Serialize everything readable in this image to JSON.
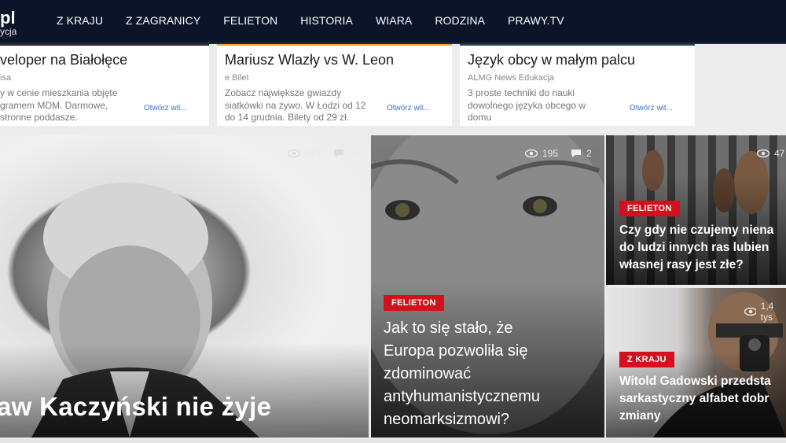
{
  "logo": {
    "line1": "pl",
    "line2": "ycja"
  },
  "nav": [
    "Z KRAJU",
    "Z ZAGRANICY",
    "FELIETON",
    "HISTORIA",
    "WIARA",
    "RODZINA",
    "PRAWY.TV"
  ],
  "ads": [
    {
      "title": "veloper na Białołęce",
      "source": "isa",
      "desc": "y w cenie mieszkania objęte\ngramem MDM. Darmowe,\nstronne poddasze.",
      "open": "Otwórz wit..."
    },
    {
      "title": "Mariusz Wlazły vs W. Leon",
      "source": "e Bilet",
      "desc": "Zobacz największe gwiazdy\nsiatkówki na żywo. W Łodzi od 12\ndo 14 grudnia. Bilety od 29 zł.",
      "open": "Otwórz wit..."
    },
    {
      "title": "Język obcy w małym palcu",
      "source": "ALMG News Edukacja",
      "desc": "3 proste techniki do nauki\ndowolnego języka obcego w\ndomu",
      "open": "Otwórz wit..."
    }
  ],
  "articles": [
    {
      "views": "477",
      "comments": "3",
      "category": "",
      "headline": "aw Kaczyński nie żyje"
    },
    {
      "views": "195",
      "comments": "2",
      "category": "FELIETON",
      "headline": "Jak to się stało, że\nEuropa pozwoliła się\nzdominować\nantyhumanistycznemu\nneomarksizmowi?"
    },
    {
      "views": "47",
      "comments": "",
      "category": "FELIETON",
      "headline": "Czy gdy nie czujemy niena\ndo ludzi innych ras lubien\nwłasnej rasy jest złe?"
    },
    {
      "views": "1,4 tys",
      "comments": "",
      "category": "Z KRAJU",
      "headline": "Witold Gadowski przedsta\nsarkastyczny alfabet dobr\nzmiany"
    }
  ],
  "colors": {
    "nav_bg": "#0b1429",
    "badge": "#d3101b",
    "link": "#3b73c8"
  }
}
